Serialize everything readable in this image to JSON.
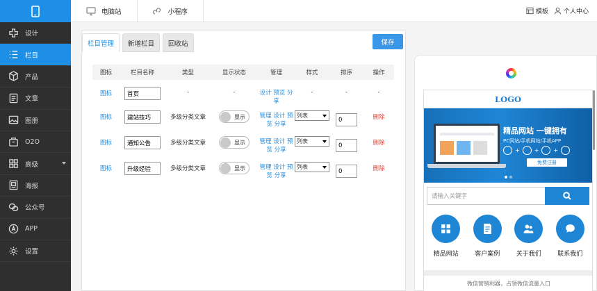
{
  "topbar": {
    "tabs": [
      {
        "label": "电脑站",
        "icon": "monitor-icon"
      },
      {
        "label": "小程序",
        "icon": "miniprogram-icon"
      }
    ],
    "template_label": "模板",
    "user_center_label": "个人中心"
  },
  "sidebar": {
    "items": [
      {
        "label": "设计",
        "icon": "design-icon",
        "active": false
      },
      {
        "label": "栏目",
        "icon": "list-icon",
        "active": true
      },
      {
        "label": "产品",
        "icon": "cube-icon",
        "active": false
      },
      {
        "label": "文章",
        "icon": "article-icon",
        "active": false
      },
      {
        "label": "图册",
        "icon": "album-icon",
        "active": false
      },
      {
        "label": "O2O",
        "icon": "store-icon",
        "active": false
      },
      {
        "label": "高级",
        "icon": "grid-icon",
        "active": false
      },
      {
        "label": "海报",
        "icon": "poster-icon",
        "active": false
      },
      {
        "label": "公众号",
        "icon": "wechat-icon",
        "active": false
      },
      {
        "label": "APP",
        "icon": "app-icon",
        "active": false
      },
      {
        "label": "设置",
        "icon": "gear-icon",
        "active": false
      }
    ]
  },
  "panel": {
    "tabs": [
      "栏目管理",
      "新增栏目",
      "回收站"
    ],
    "save_label": "保存",
    "headers": [
      "图标",
      "栏目名称",
      "类型",
      "显示状态",
      "管理",
      "样式",
      "排序",
      "操作"
    ],
    "rows": [
      {
        "icon": "图标",
        "name": "首页",
        "type": "-",
        "status": "-",
        "manage": "设计 预览 分享",
        "style": "-",
        "order": "-",
        "action": "-"
      },
      {
        "icon": "图标",
        "name": "建站技巧",
        "type": "多级分类文章",
        "status": "显示",
        "manage": "管理 设计 预览 分享",
        "style": "列表",
        "order": "0",
        "action": "删除"
      },
      {
        "icon": "图标",
        "name": "通知公告",
        "type": "多级分类文章",
        "status": "显示",
        "manage": "管理 设计 预览 分享",
        "style": "列表",
        "order": "0",
        "action": "删除"
      },
      {
        "icon": "图标",
        "name": "升级经验",
        "type": "多级分类文章",
        "status": "显示",
        "manage": "管理 设计 预览 分享",
        "style": "列表",
        "order": "0",
        "action": "删除"
      }
    ]
  },
  "preview": {
    "logo": "LOGO",
    "banner_title": "精品网站 一键拥有",
    "banner_sub": "PC网站/手机网站/手机APP",
    "banner_btn": "免费注册",
    "search_placeholder": "请输入关键字",
    "quick": [
      {
        "label": "精品网站",
        "icon": "grid-squares-icon"
      },
      {
        "label": "客户案例",
        "icon": "document-icon"
      },
      {
        "label": "关于我们",
        "icon": "people-icon"
      },
      {
        "label": "联系我们",
        "icon": "chat-icon"
      }
    ],
    "footer_text": "微信营销利器，占领微信流量入口"
  }
}
